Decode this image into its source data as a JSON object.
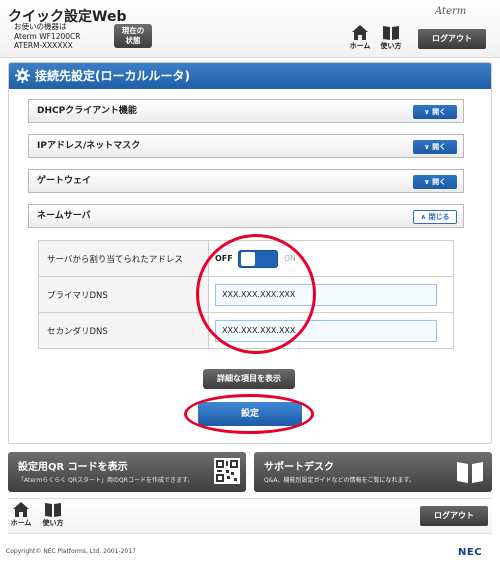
{
  "header": {
    "app_title": "クイック設定Web",
    "device_line1": "お使いの機器は",
    "device_line2": "Aterm WF1200CR",
    "device_line3": "ATERM-XXXXXX",
    "status_line1": "現在の",
    "status_line2": "状態",
    "brand": "Aterm",
    "home_label": "ホーム",
    "help_label": "使い方",
    "logout_label": "ログアウト"
  },
  "panel": {
    "title": "接続先設定(ローカルルータ)",
    "accordions": [
      {
        "label": "DHCPクライアント機能",
        "button": "開く"
      },
      {
        "label": "IPアドレス/ネットマスク",
        "button": "開く"
      },
      {
        "label": "ゲートウェイ",
        "button": "開く"
      },
      {
        "label": "ネームサーバ",
        "button": "閉じる"
      }
    ],
    "dns": {
      "auto_label": "サーバから割り当てられたアドレス",
      "toggle_off": "OFF",
      "toggle_on": "ON",
      "primary_label": "プライマリDNS",
      "primary_value": "XXX.XXX.XXX.XXX",
      "secondary_label": "セカンダリDNS",
      "secondary_value": "XXX.XXX.XXX.XXX"
    },
    "detail_button": "詳細な項目を表示",
    "set_button": "設定"
  },
  "features": {
    "qr_title": "設定用QR コードを表示",
    "qr_sub": "「Atermらくらく QRスタート」用のQRコードを作成できます。",
    "support_title": "サポートデスク",
    "support_sub": "Q&A、機能別設定ガイドなどの情報をご覧になれます。"
  },
  "footer": {
    "home_label": "ホーム",
    "help_label": "使い方",
    "logout_label": "ログアウト",
    "copyright": "Copyright© NEC Platforms, Ltd. 2001-2017",
    "nec": "NEC"
  },
  "colors": {
    "accent_blue": "#1f5fa8",
    "highlight_red": "#e8002a",
    "dark_button": "#3e3e3e"
  }
}
